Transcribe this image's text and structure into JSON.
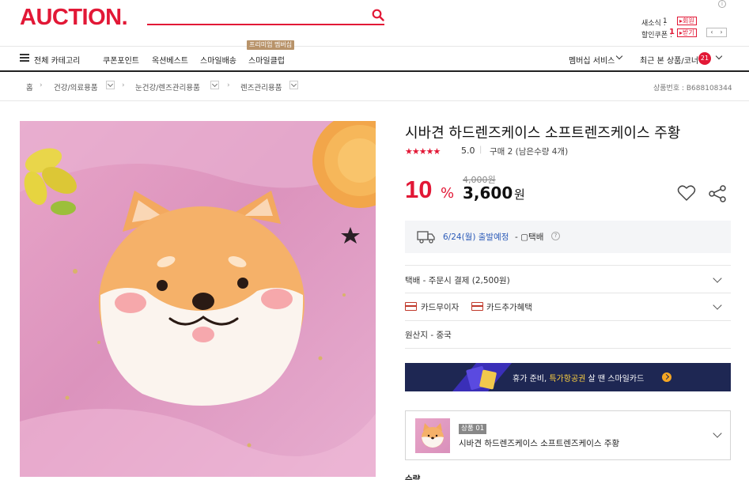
{
  "header": {
    "logo": "AUCTION.",
    "news_label": "새소식 :",
    "news_count": "1",
    "news_btn": "▸회원",
    "coupon_label": "할인쿠폰 :",
    "coupon_count": "1",
    "coupon_btn": "▸받기",
    "arrows": [
      "‹",
      "›"
    ]
  },
  "nav": {
    "category": "전체 카테고리",
    "items": [
      "쿠폰포인트",
      "옥션베스트",
      "스마일배송",
      "스마일클럽"
    ],
    "premium_badge": "프리미엄 멤버십",
    "membership": "멤버십 서비스",
    "recent": "최근 본 상품/코너",
    "recent_count": "21"
  },
  "breadcrumb": {
    "home": "홈",
    "items": [
      "건강/의료용품",
      "눈건강/렌즈관리용품",
      "렌즈관리용품"
    ],
    "product_number": "상품번호 : B688108344"
  },
  "product": {
    "title": "시바견 하드렌즈케이스 소프트렌즈케이스 주황",
    "stars": "★★★★★",
    "rating": "5.0",
    "purchase": "구매 2 (남은수량 4개)",
    "discount": "10",
    "percent": "%",
    "original_price": "4,000원",
    "sale_price": "3,600",
    "currency": "원"
  },
  "shipping": {
    "date": "6/24(월) 출발예정",
    "method": "- ▢택배",
    "help": "?"
  },
  "rows": {
    "delivery": "택배 - 주문시 결제 (2,500원)",
    "card_free": "카드무이자",
    "card_benefit": "카드추가혜택",
    "origin": "원산지 - 중국"
  },
  "banner": {
    "text_pre": "휴가 준비, ",
    "text_highlight": "특가항공권",
    "text_post": " 살 땐 스마일카드"
  },
  "option": {
    "badge": "상품 01",
    "name": "시바견 하드렌즈케이스 소프트렌즈케이스 주황"
  },
  "quantity_label": "수량",
  "colors": {
    "brand": "#e21836",
    "ship_blue": "#2c5bb8",
    "banner_bg": "#1e2753",
    "banner_highlight": "#ffd23f"
  }
}
